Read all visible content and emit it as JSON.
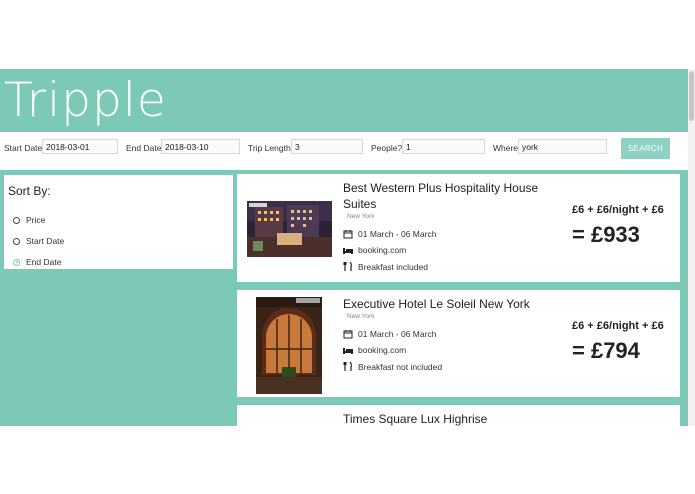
{
  "brand": {
    "logo": "Tripple"
  },
  "search": {
    "start_label": "Start Date",
    "start_value": "2018-03-01",
    "end_label": "End Date",
    "end_value": "2018-03-10",
    "length_label": "Trip Length",
    "length_value": "3",
    "people_label": "People?",
    "people_value": "1",
    "where_label": "Where",
    "where_value": "york",
    "button": "SEARCH"
  },
  "sort": {
    "title": "Sort By:",
    "options": [
      {
        "label": "Price",
        "checked": false
      },
      {
        "label": "Start Date",
        "checked": false
      },
      {
        "label": "End Date",
        "checked": true
      }
    ]
  },
  "hotels": [
    {
      "name_line1": "Best Western Plus Hospitality House",
      "name_line2": "Suites",
      "location": "New York",
      "dates": "01 March - 06 March",
      "provider": "booking.com",
      "breakfast": "Breakfast included",
      "price_breakdown": "£6 + £6/night + £6",
      "total": "= £933"
    },
    {
      "name_line1": "Executive Hotel Le Soleil New York",
      "location": "New York",
      "dates": "01 March - 06 March",
      "provider": "booking.com",
      "breakfast": "Breakfast not included",
      "price_breakdown": "£6 + £6/night + £6",
      "total": "= £794"
    },
    {
      "name_line1": "Times Square Lux Highrise"
    }
  ],
  "colors": {
    "accent": "#7cc9b8",
    "button": "#8fd1c3"
  }
}
